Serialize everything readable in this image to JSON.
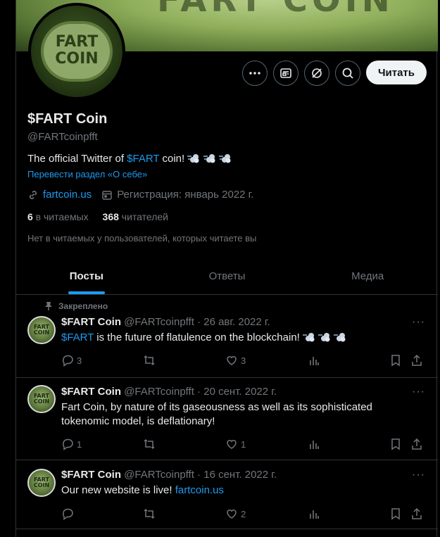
{
  "profile": {
    "banner_text": "FART COIN",
    "avatar_text_line1": "FART",
    "avatar_text_line2": "COIN",
    "name": "$FART Coin",
    "handle": "@FARTcoinpfft",
    "bio_prefix": "The official Twitter of ",
    "bio_link": "$FART",
    "bio_suffix": " coin! ",
    "bio_emoji": "dash-emoji x3",
    "translate_label": "Перевести раздел «О себе»",
    "website": "fartcoin.us",
    "joined": "Регистрация: январь 2022 г.",
    "following_count": "6",
    "following_label": " в читаемых",
    "followers_count": "368",
    "followers_label": " читателей",
    "followed_by": "Нет в читаемых у пользователей, которых читаете вы",
    "follow_button": "Читать"
  },
  "buttons": {
    "more": "more-icon",
    "subscribe": "newsletter-icon",
    "grok": "grok-icon",
    "search": "search-icon"
  },
  "tabs": [
    {
      "label": "Посты",
      "active": true
    },
    {
      "label": "Ответы",
      "active": false
    },
    {
      "label": "Медиа",
      "active": false
    }
  ],
  "posts": [
    {
      "pinned_label": "Закреплено",
      "name": "$FART Coin",
      "handle_date": "@FARTcoinpfft · 26 авг. 2022 г.",
      "text_link": "$FART",
      "text": " is the future of flatulence on the blockchain! ",
      "replies": "3",
      "reposts": "",
      "likes": "3"
    },
    {
      "name": "$FART Coin",
      "handle_date": "@FARTcoinpfft · 20 сент. 2022 г.",
      "text": "Fart Coin, by nature of its gaseousness as well as its sophisticated tokenomic model, is deflationary!",
      "replies": "1",
      "reposts": "",
      "likes": "1"
    },
    {
      "name": "$FART Coin",
      "handle_date": "@FARTcoinpfft · 16 сент. 2022 г.",
      "text": "Our new website is live! ",
      "text_link": "fartcoin.us",
      "replies": "",
      "reposts": "",
      "likes": "2"
    }
  ],
  "colors": {
    "accent": "#1d9bf0",
    "background": "#000000",
    "muted": "#71767b",
    "border": "#2f3336"
  }
}
